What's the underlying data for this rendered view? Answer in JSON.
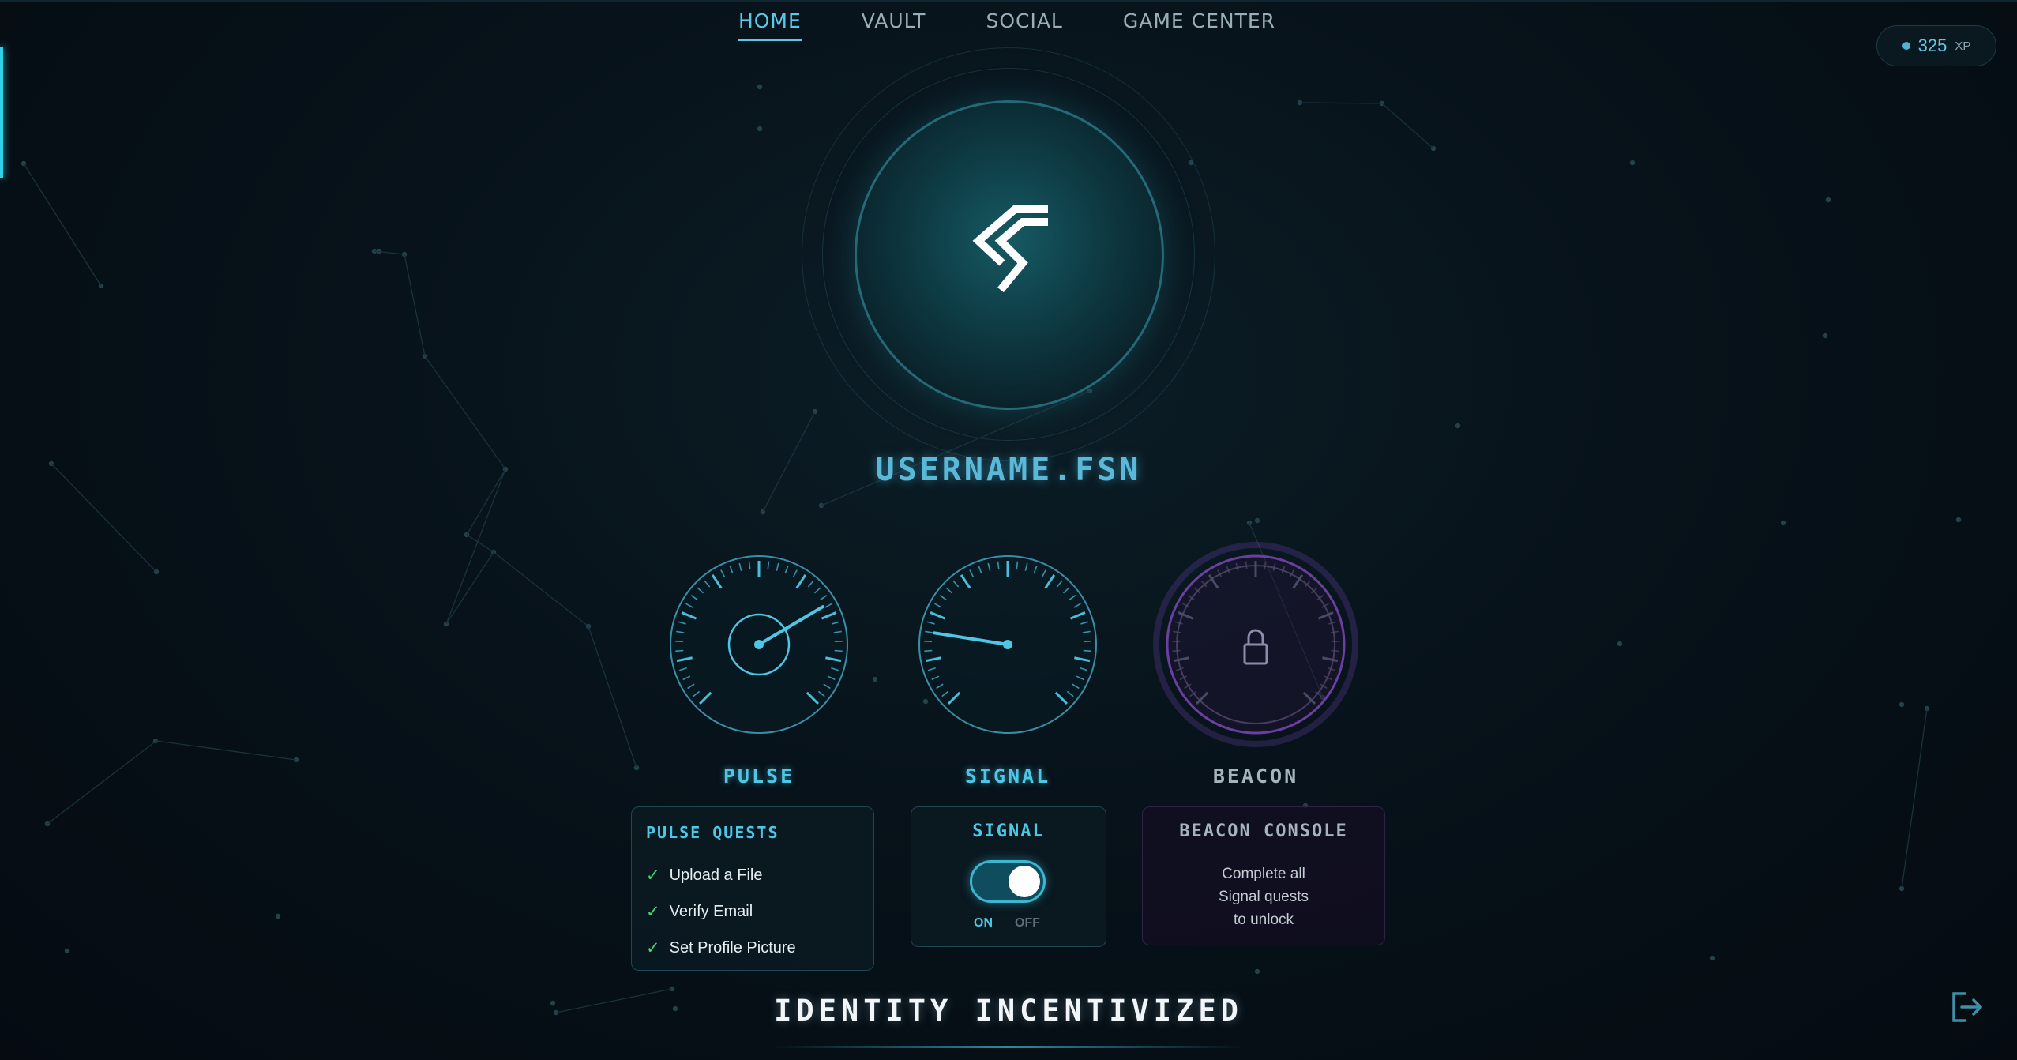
{
  "nav": {
    "items": [
      {
        "label": "HOME",
        "active": true
      },
      {
        "label": "VAULT",
        "active": false
      },
      {
        "label": "SOCIAL",
        "active": false
      },
      {
        "label": "GAME CENTER",
        "active": false
      }
    ]
  },
  "xp": {
    "value": "325",
    "unit": "XP"
  },
  "profile": {
    "username": "USERNAME.FSN",
    "logo_icon": "fsn-logo-icon"
  },
  "gauges": [
    {
      "label": "PULSE",
      "color": "#4ec6e6",
      "state": "active",
      "needle_fraction": 0.72
    },
    {
      "label": "SIGNAL",
      "color": "#4ec6e6",
      "state": "active",
      "needle_fraction": 0.2
    },
    {
      "label": "BEACON",
      "color": "#8a5fc4",
      "state": "locked",
      "icon": "lock-icon"
    }
  ],
  "cards": {
    "pulse": {
      "title": "PULSE QUESTS",
      "quests": [
        {
          "label": "Upload a File",
          "done": true
        },
        {
          "label": "Verify Email",
          "done": true
        },
        {
          "label": "Set Profile Picture",
          "done": true
        }
      ]
    },
    "signal": {
      "title": "SIGNAL",
      "on_label": "ON",
      "off_label": "OFF",
      "enabled": true
    },
    "beacon": {
      "title": "BEACON CONSOLE",
      "line1": "Complete all",
      "line2": "Signal quests",
      "line3": "to unlock"
    }
  },
  "tagline": "IDENTITY INCENTIVIZED",
  "colors": {
    "accent": "#5ac8e6",
    "check": "#43d66f",
    "beacon": "#8a5fc4",
    "background": "#07121a"
  },
  "icons": {
    "logout": "logout-icon"
  }
}
